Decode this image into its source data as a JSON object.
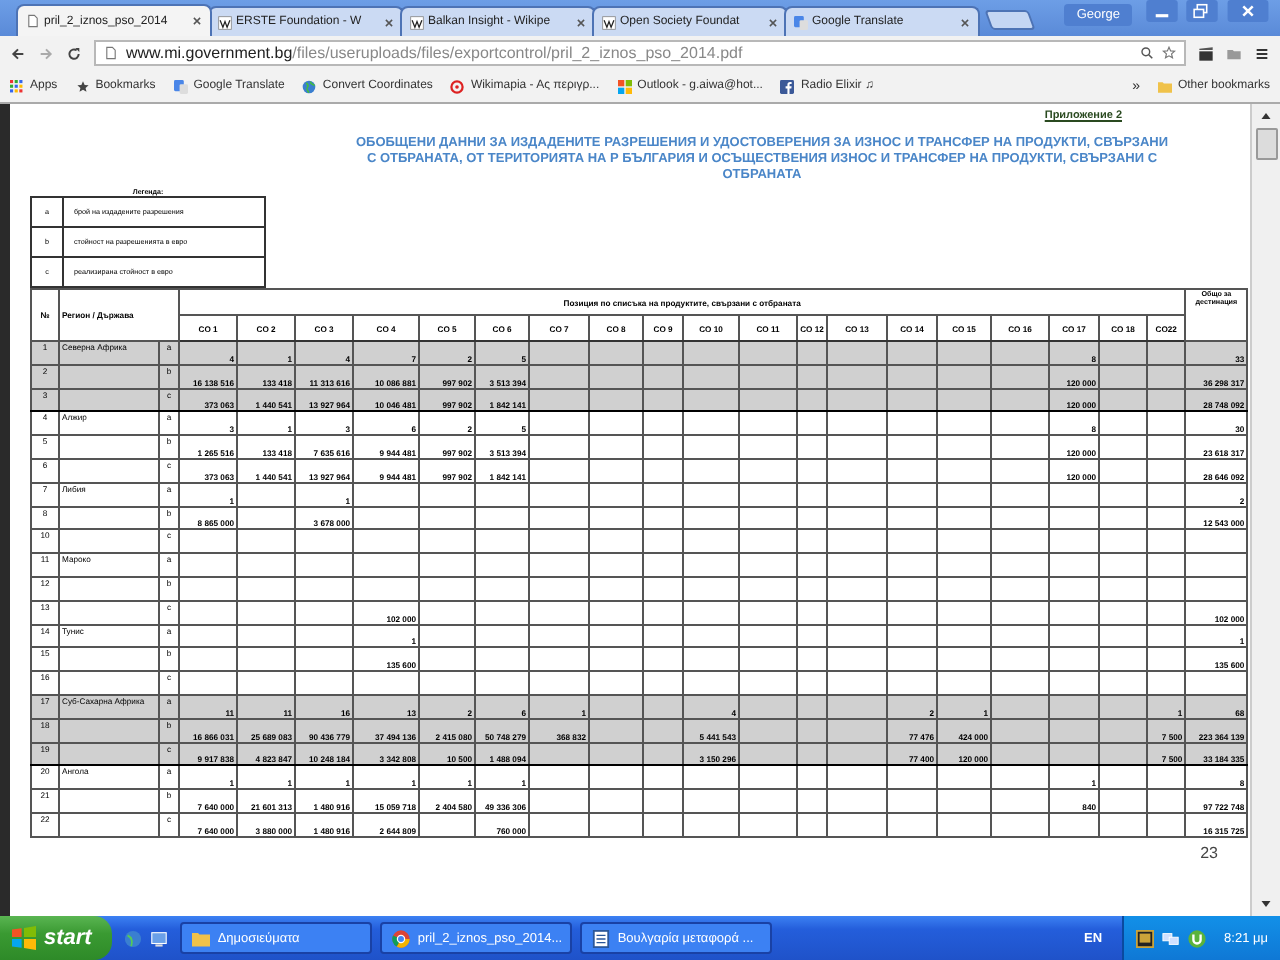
{
  "browser": {
    "tabs": [
      {
        "title": "pril_2_iznos_pso_2014",
        "selected": true
      },
      {
        "title": "ERSTE Foundation - W",
        "selected": false
      },
      {
        "title": "Balkan Insight - Wikipe",
        "selected": false
      },
      {
        "title": "Open Society Foundat",
        "selected": false
      },
      {
        "title": "Google Translate",
        "selected": false
      }
    ],
    "user": "George",
    "url_host": "www.mi.government.bg",
    "url_path": "/files/useruploads/files/exportcontrol/pril_2_iznos_pso_2014.pdf",
    "bookmarks": [
      "Apps",
      "Bookmarks",
      "Google Translate",
      "Convert Coordinates",
      "Wikimapia - Aς περιγρ...",
      "Outlook - g.aiwa@hot...",
      "Radio Elixir ♫"
    ],
    "more": "»",
    "other_bookmarks": "Other bookmarks"
  },
  "document": {
    "annex": "Приложение 2",
    "title": "ОБОБЩЕНИ ДАННИ ЗА ИЗДАДЕНИТЕ РАЗРЕШЕНИЯ И УДОСТОВЕРЕНИЯ ЗА ИЗНОС И ТРАНСФЕР НА ПРОДУКТИ, СВЪРЗАНИ С ОТБРАНАТА, ОТ ТЕРИТОРИЯТА НА Р БЪЛГАРИЯ И ОСЪЩЕСТВЕНИЯ ИЗНОС И ТРАНСФЕР НА ПРОДУКТИ, СВЪРЗАНИ С ОТБРАНАТА",
    "legend_title": "Легенда:",
    "legend": [
      {
        "letter": "a",
        "text": "брой на издадените разрешения"
      },
      {
        "letter": "b",
        "text": "стойност на разрешенията в евро"
      },
      {
        "letter": "c",
        "text": "реализирана стойност в евро"
      }
    ],
    "table": {
      "no_header": "№",
      "region_header": "Регион / Държава",
      "positions_header": "Позиция по списъка на продуктите, свързани с отбраната",
      "total_header": "Общо за дестинация",
      "columns": [
        "CO 1",
        "CO 2",
        "CO 3",
        "CO 4",
        "CO 5",
        "CO 6",
        "CO 7",
        "CO 8",
        "CO 9",
        "CO 10",
        "CO 11",
        "CO 12",
        "CO 13",
        "CO 14",
        "CO 15",
        "CO 16",
        "CO 17",
        "CO 18",
        "CO22"
      ],
      "groups": [
        {
          "kind": "region",
          "name": "Северна Африка",
          "rows": [
            {
              "no": "1",
              "letter": "a",
              "cells": [
                "4",
                "1",
                "4",
                "7",
                "2",
                "5",
                null,
                null,
                null,
                null,
                null,
                null,
                null,
                null,
                null,
                null,
                "8",
                null,
                null
              ],
              "total": "33"
            },
            {
              "no": "2",
              "letter": "b",
              "cells": [
                "16 138 516",
                "133 418",
                "11 313 616",
                "10 086 881",
                "997 902",
                "3 513 394",
                null,
                null,
                null,
                null,
                null,
                null,
                null,
                null,
                null,
                null,
                "120 000",
                null,
                null
              ],
              "total": "36 298 317"
            },
            {
              "no": "3",
              "letter": "c",
              "cells": [
                "373 063",
                "1 440 541",
                "13 927 964",
                "10 046 481",
                "997 902",
                "1 842 141",
                null,
                null,
                null,
                null,
                null,
                null,
                null,
                null,
                null,
                null,
                "120 000",
                null,
                null
              ],
              "total": "28 748 092"
            }
          ]
        },
        {
          "kind": "country",
          "name": "Алжир",
          "rows": [
            {
              "no": "4",
              "letter": "a",
              "cells": [
                "3",
                "1",
                "3",
                "6",
                "2",
                "5",
                null,
                null,
                null,
                null,
                null,
                null,
                null,
                null,
                null,
                null,
                "8",
                null,
                null
              ],
              "total": "30"
            },
            {
              "no": "5",
              "letter": "b",
              "cells": [
                "1 265 516",
                "133 418",
                "7 635 616",
                "9 944 481",
                "997 902",
                "3 513 394",
                null,
                null,
                null,
                null,
                null,
                null,
                null,
                null,
                null,
                null,
                "120 000",
                null,
                null
              ],
              "total": "23 618 317"
            },
            {
              "no": "6",
              "letter": "c",
              "cells": [
                "373 063",
                "1 440 541",
                "13 927 964",
                "9 944 481",
                "997 902",
                "1 842 141",
                null,
                null,
                null,
                null,
                null,
                null,
                null,
                null,
                null,
                null,
                "120 000",
                null,
                null
              ],
              "total": "28 646 092"
            }
          ]
        },
        {
          "kind": "country",
          "name": "Либия",
          "rows": [
            {
              "no": "7",
              "letter": "a",
              "cells": [
                "1",
                null,
                "1",
                null,
                null,
                null,
                null,
                null,
                null,
                null,
                null,
                null,
                null,
                null,
                null,
                null,
                null,
                null,
                null
              ],
              "total": "2"
            },
            {
              "no": "8",
              "letter": "b",
              "cells": [
                "8 865 000",
                null,
                "3 678 000",
                null,
                null,
                null,
                null,
                null,
                null,
                null,
                null,
                null,
                null,
                null,
                null,
                null,
                null,
                null,
                null
              ],
              "total": "12 543 000"
            },
            {
              "no": "10",
              "letter": "c"
            }
          ]
        },
        {
          "kind": "country",
          "name": "Мароко",
          "rows": [
            {
              "no": "11",
              "letter": "a"
            },
            {
              "no": "12",
              "letter": "b"
            },
            {
              "no": "13",
              "letter": "c",
              "cells": [
                null,
                null,
                null,
                "102 000",
                null,
                null,
                null,
                null,
                null,
                null,
                null,
                null,
                null,
                null,
                null,
                null,
                null,
                null,
                null
              ],
              "total": "102 000"
            }
          ]
        },
        {
          "kind": "country",
          "name": "Тунис",
          "rows": [
            {
              "no": "14",
              "letter": "a",
              "cells": [
                null,
                null,
                null,
                "1",
                null,
                null,
                null,
                null,
                null,
                null,
                null,
                null,
                null,
                null,
                null,
                null,
                null,
                null,
                null
              ],
              "total": "1"
            },
            {
              "no": "15",
              "letter": "b",
              "cells": [
                null,
                null,
                null,
                "135 600",
                null,
                null,
                null,
                null,
                null,
                null,
                null,
                null,
                null,
                null,
                null,
                null,
                null,
                null,
                null
              ],
              "total": "135 600"
            },
            {
              "no": "16",
              "letter": "c"
            }
          ]
        },
        {
          "kind": "region",
          "name": "Суб-Сахарна Африка",
          "rows": [
            {
              "no": "17",
              "letter": "a",
              "cells": [
                "11",
                "11",
                "16",
                "13",
                "2",
                "6",
                "1",
                null,
                null,
                "4",
                null,
                null,
                null,
                "2",
                "1",
                null,
                null,
                null,
                "1"
              ],
              "total": "68"
            },
            {
              "no": "18",
              "letter": "b",
              "cells": [
                "16 866 031",
                "25 689 083",
                "90 436 779",
                "37 494 136",
                "2 415 080",
                "50 748 279",
                "368 832",
                null,
                null,
                "5 441 543",
                null,
                null,
                null,
                "77 476",
                "424 000",
                null,
                null,
                null,
                "7 500"
              ],
              "total": "223 364 139"
            },
            {
              "no": "19",
              "letter": "c",
              "cells": [
                "9 917 838",
                "4 823 847",
                "10 248 184",
                "3 342 808",
                "10 500",
                "1 488 094",
                null,
                null,
                null,
                "3 150 296",
                null,
                null,
                null,
                "77 400",
                "120 000",
                null,
                null,
                null,
                "7 500"
              ],
              "total": "33 184 335"
            }
          ]
        },
        {
          "kind": "country",
          "name": "Ангола",
          "rows": [
            {
              "no": "20",
              "letter": "a",
              "cells": [
                "1",
                "1",
                "1",
                "1",
                "1",
                "1",
                null,
                null,
                null,
                null,
                null,
                null,
                null,
                null,
                null,
                null,
                "1",
                null,
                null
              ],
              "total": "8"
            },
            {
              "no": "21",
              "letter": "b",
              "cells": [
                "7 640 000",
                "21 601 313",
                "1 480 916",
                "15 059 718",
                "2 404 580",
                "49 336 306",
                null,
                null,
                null,
                null,
                null,
                null,
                null,
                null,
                null,
                null,
                "840",
                null,
                null
              ],
              "total": "97 722 748"
            },
            {
              "no": "22",
              "letter": "c",
              "cells": [
                "7 640 000",
                "3 880 000",
                "1 480 916",
                "2 644 809",
                null,
                "760 000",
                null,
                null,
                null,
                null,
                null,
                null,
                null,
                null,
                null,
                null,
                null,
                null,
                null
              ],
              "total": "16 315 725"
            }
          ]
        }
      ]
    },
    "page_number": "23"
  },
  "taskbar": {
    "start": "start",
    "items": [
      "Δημοσιεύματα",
      "pril_2_iznos_pso_2014...",
      "Βουλγαρία μεταφορά ..."
    ],
    "language": "EN",
    "clock": "8:21 μμ"
  }
}
